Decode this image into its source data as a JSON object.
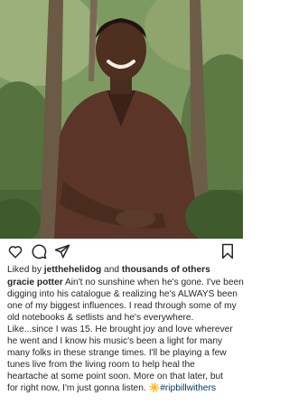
{
  "post": {
    "image_alt": "Smiling man in a brown shirt sitting among trees",
    "liked_prefix": "Liked by",
    "liked_user": "jetthehelidog",
    "liked_and": "and",
    "liked_others": "thousands of others",
    "author": "gracie potter",
    "caption_lines": [
      "Ain't no sunshine when he's gone. I've been",
      "digging into his catalogue & realizing he's ALWAYS been",
      "one of my biggest influences. I read through some of my",
      "old notebooks & setlists and he's everywhere.",
      "Like...since I was 15. He brought joy and love wherever",
      "he went and I know his music's been a light for many",
      "many folks in these strange times. I'll be playing a few",
      "tunes live from the living room to help heal the",
      "heartache at some point soon.  More on that later, but",
      "for right now, I'm just gonna listen. ☀️"
    ],
    "hashtag": "#ripbillwithers"
  },
  "icons": {
    "like": "heart-outline-icon",
    "comment": "comment-bubble-icon",
    "share": "paper-plane-icon",
    "save": "bookmark-icon"
  }
}
